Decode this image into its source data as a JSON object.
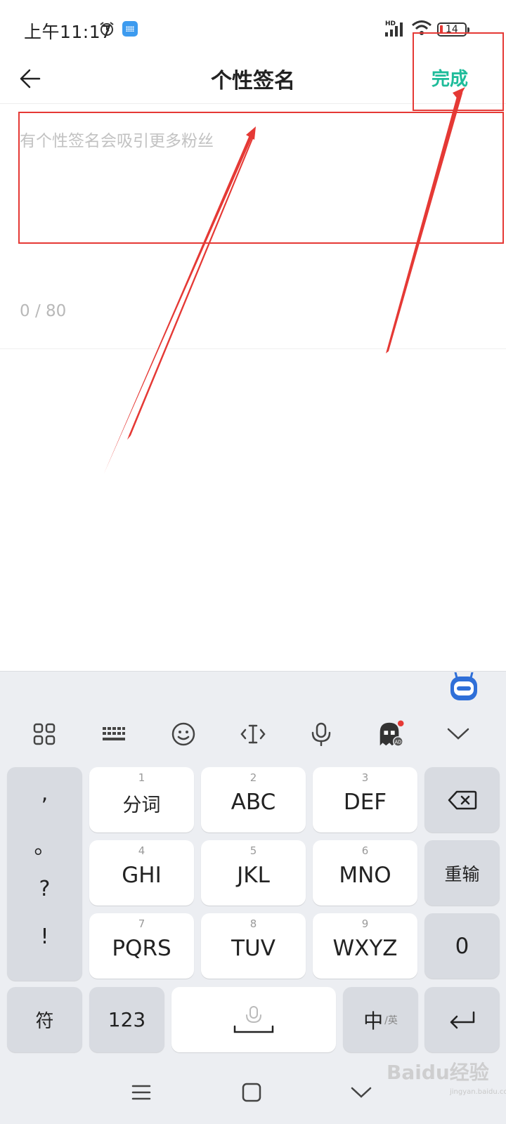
{
  "status_bar": {
    "time": "上午11:17",
    "battery_level": "14"
  },
  "header": {
    "title": "个性签名",
    "done_label": "完成"
  },
  "bio": {
    "placeholder": "有个性签名会吸引更多粉丝",
    "value": "",
    "counter": "0 / 80"
  },
  "keyboard": {
    "toolbar_icons": [
      "grid-icon",
      "keyboard-icon",
      "emoji-icon",
      "text-cursor-icon",
      "microphone-icon",
      "ghost-ad-icon",
      "chevron-down-icon"
    ],
    "punctuation": [
      ",",
      "。",
      "?",
      "!"
    ],
    "keys": [
      {
        "num": "1",
        "label": "分词"
      },
      {
        "num": "2",
        "label": "ABC"
      },
      {
        "num": "3",
        "label": "DEF"
      },
      {
        "num": "4",
        "label": "GHI"
      },
      {
        "num": "5",
        "label": "JKL"
      },
      {
        "num": "6",
        "label": "MNO"
      },
      {
        "num": "7",
        "label": "PQRS"
      },
      {
        "num": "8",
        "label": "TUV"
      },
      {
        "num": "9",
        "label": "WXYZ"
      }
    ],
    "retype_label": "重输",
    "zero_label": "0",
    "symbol_label": "符",
    "numbers_label": "123",
    "lang_main": "中",
    "lang_sub": "/英"
  },
  "nav_bar": {
    "icons": [
      "menu-icon",
      "home-icon",
      "back-chevron-icon"
    ]
  },
  "watermark": {
    "text": "Baidu经验",
    "sub": "jingyan.baidu.com"
  },
  "colors": {
    "accent": "#1ebc9a",
    "annotation": "#e53935",
    "keyboard_bg": "#eceef2"
  }
}
